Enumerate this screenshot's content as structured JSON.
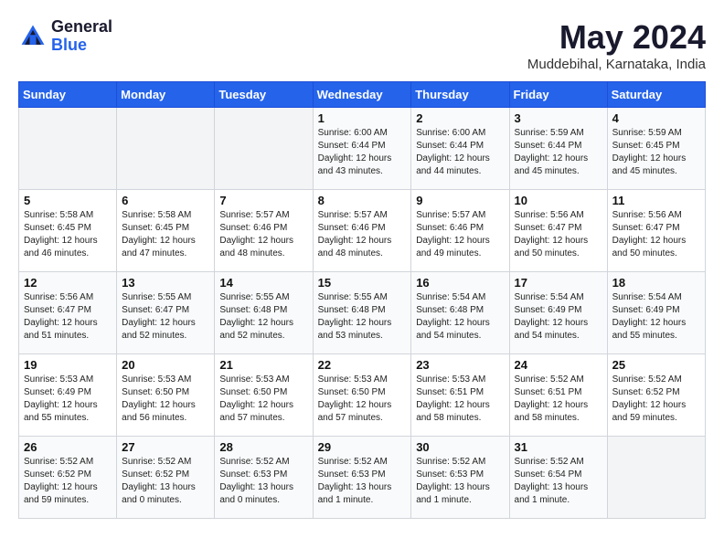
{
  "logo": {
    "general": "General",
    "blue": "Blue"
  },
  "title": "May 2024",
  "location": "Muddebihal, Karnataka, India",
  "days_header": [
    "Sunday",
    "Monday",
    "Tuesday",
    "Wednesday",
    "Thursday",
    "Friday",
    "Saturday"
  ],
  "weeks": [
    [
      {
        "day": "",
        "info": ""
      },
      {
        "day": "",
        "info": ""
      },
      {
        "day": "",
        "info": ""
      },
      {
        "day": "1",
        "info": "Sunrise: 6:00 AM\nSunset: 6:44 PM\nDaylight: 12 hours\nand 43 minutes."
      },
      {
        "day": "2",
        "info": "Sunrise: 6:00 AM\nSunset: 6:44 PM\nDaylight: 12 hours\nand 44 minutes."
      },
      {
        "day": "3",
        "info": "Sunrise: 5:59 AM\nSunset: 6:44 PM\nDaylight: 12 hours\nand 45 minutes."
      },
      {
        "day": "4",
        "info": "Sunrise: 5:59 AM\nSunset: 6:45 PM\nDaylight: 12 hours\nand 45 minutes."
      }
    ],
    [
      {
        "day": "5",
        "info": "Sunrise: 5:58 AM\nSunset: 6:45 PM\nDaylight: 12 hours\nand 46 minutes."
      },
      {
        "day": "6",
        "info": "Sunrise: 5:58 AM\nSunset: 6:45 PM\nDaylight: 12 hours\nand 47 minutes."
      },
      {
        "day": "7",
        "info": "Sunrise: 5:57 AM\nSunset: 6:46 PM\nDaylight: 12 hours\nand 48 minutes."
      },
      {
        "day": "8",
        "info": "Sunrise: 5:57 AM\nSunset: 6:46 PM\nDaylight: 12 hours\nand 48 minutes."
      },
      {
        "day": "9",
        "info": "Sunrise: 5:57 AM\nSunset: 6:46 PM\nDaylight: 12 hours\nand 49 minutes."
      },
      {
        "day": "10",
        "info": "Sunrise: 5:56 AM\nSunset: 6:47 PM\nDaylight: 12 hours\nand 50 minutes."
      },
      {
        "day": "11",
        "info": "Sunrise: 5:56 AM\nSunset: 6:47 PM\nDaylight: 12 hours\nand 50 minutes."
      }
    ],
    [
      {
        "day": "12",
        "info": "Sunrise: 5:56 AM\nSunset: 6:47 PM\nDaylight: 12 hours\nand 51 minutes."
      },
      {
        "day": "13",
        "info": "Sunrise: 5:55 AM\nSunset: 6:47 PM\nDaylight: 12 hours\nand 52 minutes."
      },
      {
        "day": "14",
        "info": "Sunrise: 5:55 AM\nSunset: 6:48 PM\nDaylight: 12 hours\nand 52 minutes."
      },
      {
        "day": "15",
        "info": "Sunrise: 5:55 AM\nSunset: 6:48 PM\nDaylight: 12 hours\nand 53 minutes."
      },
      {
        "day": "16",
        "info": "Sunrise: 5:54 AM\nSunset: 6:48 PM\nDaylight: 12 hours\nand 54 minutes."
      },
      {
        "day": "17",
        "info": "Sunrise: 5:54 AM\nSunset: 6:49 PM\nDaylight: 12 hours\nand 54 minutes."
      },
      {
        "day": "18",
        "info": "Sunrise: 5:54 AM\nSunset: 6:49 PM\nDaylight: 12 hours\nand 55 minutes."
      }
    ],
    [
      {
        "day": "19",
        "info": "Sunrise: 5:53 AM\nSunset: 6:49 PM\nDaylight: 12 hours\nand 55 minutes."
      },
      {
        "day": "20",
        "info": "Sunrise: 5:53 AM\nSunset: 6:50 PM\nDaylight: 12 hours\nand 56 minutes."
      },
      {
        "day": "21",
        "info": "Sunrise: 5:53 AM\nSunset: 6:50 PM\nDaylight: 12 hours\nand 57 minutes."
      },
      {
        "day": "22",
        "info": "Sunrise: 5:53 AM\nSunset: 6:50 PM\nDaylight: 12 hours\nand 57 minutes."
      },
      {
        "day": "23",
        "info": "Sunrise: 5:53 AM\nSunset: 6:51 PM\nDaylight: 12 hours\nand 58 minutes."
      },
      {
        "day": "24",
        "info": "Sunrise: 5:52 AM\nSunset: 6:51 PM\nDaylight: 12 hours\nand 58 minutes."
      },
      {
        "day": "25",
        "info": "Sunrise: 5:52 AM\nSunset: 6:52 PM\nDaylight: 12 hours\nand 59 minutes."
      }
    ],
    [
      {
        "day": "26",
        "info": "Sunrise: 5:52 AM\nSunset: 6:52 PM\nDaylight: 12 hours\nand 59 minutes."
      },
      {
        "day": "27",
        "info": "Sunrise: 5:52 AM\nSunset: 6:52 PM\nDaylight: 13 hours\nand 0 minutes."
      },
      {
        "day": "28",
        "info": "Sunrise: 5:52 AM\nSunset: 6:53 PM\nDaylight: 13 hours\nand 0 minutes."
      },
      {
        "day": "29",
        "info": "Sunrise: 5:52 AM\nSunset: 6:53 PM\nDaylight: 13 hours\nand 1 minute."
      },
      {
        "day": "30",
        "info": "Sunrise: 5:52 AM\nSunset: 6:53 PM\nDaylight: 13 hours\nand 1 minute."
      },
      {
        "day": "31",
        "info": "Sunrise: 5:52 AM\nSunset: 6:54 PM\nDaylight: 13 hours\nand 1 minute."
      },
      {
        "day": "",
        "info": ""
      }
    ]
  ]
}
